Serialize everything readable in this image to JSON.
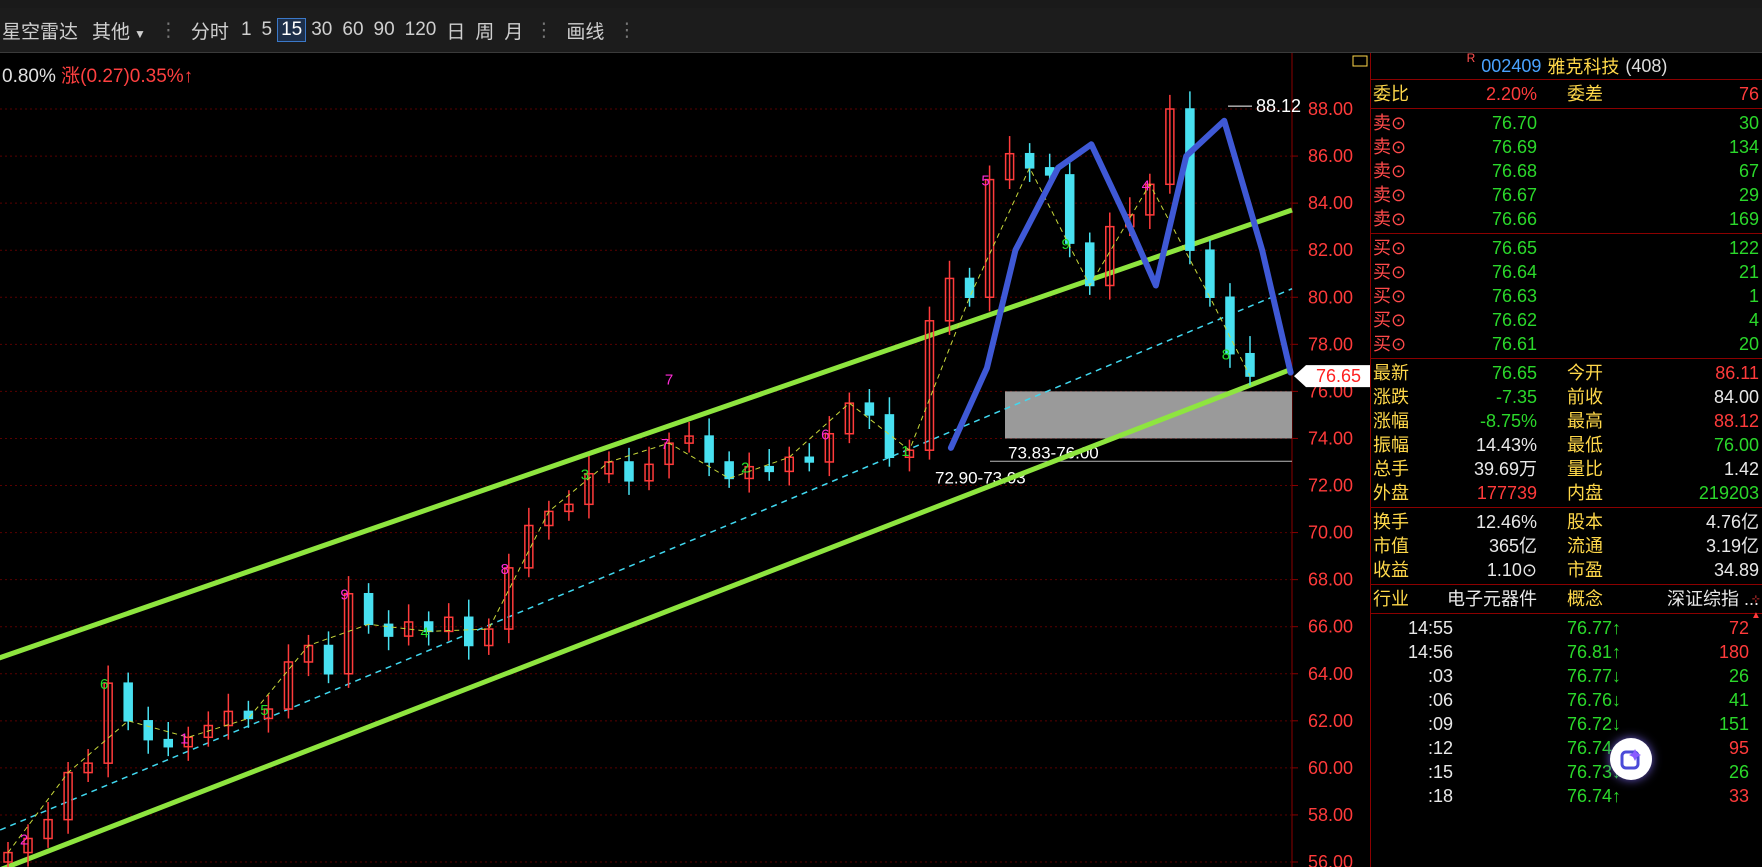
{
  "toolbar": {
    "app_name": "星空雷达",
    "other_label": "其他",
    "fenshi": "分时",
    "periods": [
      "1",
      "5",
      "15",
      "30",
      "60",
      "90",
      "120",
      "日",
      "周",
      "月"
    ],
    "active_period": "15",
    "draw_label": "画线"
  },
  "info_line": {
    "prefix": "0.80%",
    "change": "涨(0.27)0.35%↑"
  },
  "chart": {
    "y_ticks": [
      "88.00",
      "86.00",
      "84.00",
      "82.00",
      "80.00",
      "78.00",
      "76.00",
      "74.00",
      "72.00",
      "70.00",
      "68.00",
      "66.00",
      "64.00",
      "62.00",
      "60.00",
      "58.00",
      "56.00"
    ],
    "y_range": [
      56,
      89
    ],
    "high_label": "88.12",
    "current_price": "76.65",
    "zone_label": "73.83-76.00",
    "support_label": "72.90-73.03",
    "zone": [
      74.0,
      76.0
    ],
    "support_line": 73.03,
    "tag_number": "7",
    "colors": {
      "channel": "#8ee53f",
      "hand_line": "#3f59d6",
      "zone": "#9a9a9a",
      "up": "#ff3b3b",
      "down": "#48e0f0",
      "seq_magenta": "#ff2bd6",
      "seq_green": "#25e02b"
    }
  },
  "chart_data": {
    "type": "candlestick",
    "ylim": [
      56,
      89
    ],
    "channel_upper": [
      [
        0,
        64.8
      ],
      [
        60,
        82.5
      ]
    ],
    "channel_lower": [
      [
        0,
        55.8
      ],
      [
        60,
        75.6
      ]
    ],
    "trend_guide": [
      [
        0,
        57.5
      ],
      [
        60,
        78.9
      ]
    ],
    "closes": [
      56.4,
      57.0,
      57.8,
      59.8,
      60.2,
      63.6,
      62.0,
      61.2,
      60.9,
      61.3,
      61.8,
      62.4,
      62.1,
      62.5,
      64.5,
      65.2,
      64.0,
      67.4,
      66.1,
      65.6,
      66.2,
      65.8,
      66.4,
      65.2,
      65.9,
      68.5,
      70.3,
      70.9,
      71.2,
      72.5,
      73.0,
      72.2,
      72.9,
      73.8,
      74.1,
      73.0,
      72.3,
      72.8,
      72.6,
      73.2,
      73.0,
      74.2,
      75.5,
      75.0,
      73.2,
      73.5,
      79.0,
      80.8,
      80.0,
      85.0,
      86.1,
      85.5,
      85.2,
      82.3,
      80.5,
      83.0,
      83.5,
      84.8,
      88.0,
      82.0,
      80.0,
      77.6,
      76.65
    ]
  },
  "panel": {
    "code": "002409",
    "name": "雅克科技",
    "count": "(408)",
    "r_mark": "R",
    "weibi": {
      "label": "委比",
      "value": "2.20%",
      "label2": "委差",
      "value2": "76"
    },
    "sell": [
      {
        "label": "卖⊙",
        "price": "76.70",
        "vol": "30"
      },
      {
        "label": "卖⊙",
        "price": "76.69",
        "vol": "134"
      },
      {
        "label": "卖⊙",
        "price": "76.68",
        "vol": "67"
      },
      {
        "label": "卖⊙",
        "price": "76.67",
        "vol": "29"
      },
      {
        "label": "卖⊙",
        "price": "76.66",
        "vol": "169"
      }
    ],
    "buy": [
      {
        "label": "买⊙",
        "price": "76.65",
        "vol": "122"
      },
      {
        "label": "买⊙",
        "price": "76.64",
        "vol": "21"
      },
      {
        "label": "买⊙",
        "price": "76.63",
        "vol": "1"
      },
      {
        "label": "买⊙",
        "price": "76.62",
        "vol": "4"
      },
      {
        "label": "买⊙",
        "price": "76.61",
        "vol": "20"
      }
    ],
    "stats": [
      {
        "l1": "最新",
        "v1": "76.65",
        "c1": "green",
        "l2": "今开",
        "v2": "86.11",
        "c2": "red"
      },
      {
        "l1": "涨跌",
        "v1": "-7.35",
        "c1": "green",
        "l2": "前收",
        "v2": "84.00",
        "c2": "white"
      },
      {
        "l1": "涨幅",
        "v1": "-8.75%",
        "c1": "green",
        "l2": "最高",
        "v2": "88.12",
        "c2": "red"
      },
      {
        "l1": "振幅",
        "v1": "14.43%",
        "c1": "white",
        "l2": "最低",
        "v2": "76.00",
        "c2": "green"
      },
      {
        "l1": "总手",
        "v1": "39.69万",
        "c1": "white",
        "l2": "量比",
        "v2": "1.42",
        "c2": "white"
      },
      {
        "l1": "外盘",
        "v1": "177739",
        "c1": "red",
        "l2": "内盘",
        "v2": "219203",
        "c2": "green"
      }
    ],
    "stats2": [
      {
        "l1": "换手",
        "v1": "12.46%",
        "l2": "股本",
        "v2": "4.76亿"
      },
      {
        "l1": "市值",
        "v1": "365亿",
        "l2": "流通",
        "v2": "3.19亿"
      },
      {
        "l1": "收益",
        "v1": "1.10⊙",
        "l2": "市盈",
        "v2": "34.89"
      }
    ],
    "industry": {
      "label": "行业",
      "value": "电子元器件",
      "label2": "概念",
      "value2": "深证综指 ..."
    },
    "ticks": [
      {
        "time": "14:55",
        "price": "76.77↑",
        "pc": "green",
        "vol": "72",
        "vc": "red"
      },
      {
        "time": "14:56",
        "price": "76.81↑",
        "pc": "green",
        "vol": "180",
        "vc": "red"
      },
      {
        "time": ":03",
        "price": "76.77↓",
        "pc": "green",
        "vol": "26",
        "vc": "green"
      },
      {
        "time": ":06",
        "price": "76.76↓",
        "pc": "green",
        "vol": "41",
        "vc": "green"
      },
      {
        "time": ":09",
        "price": "76.72↓",
        "pc": "green",
        "vol": "151",
        "vc": "green"
      },
      {
        "time": ":12",
        "price": "76.74↑",
        "pc": "green",
        "vol": "95",
        "vc": "red"
      },
      {
        "time": ":15",
        "price": "76.73↓",
        "pc": "green",
        "vol": "26",
        "vc": "green"
      },
      {
        "time": ":18",
        "price": "76.74↑",
        "pc": "green",
        "vol": "33",
        "vc": "red"
      }
    ]
  }
}
